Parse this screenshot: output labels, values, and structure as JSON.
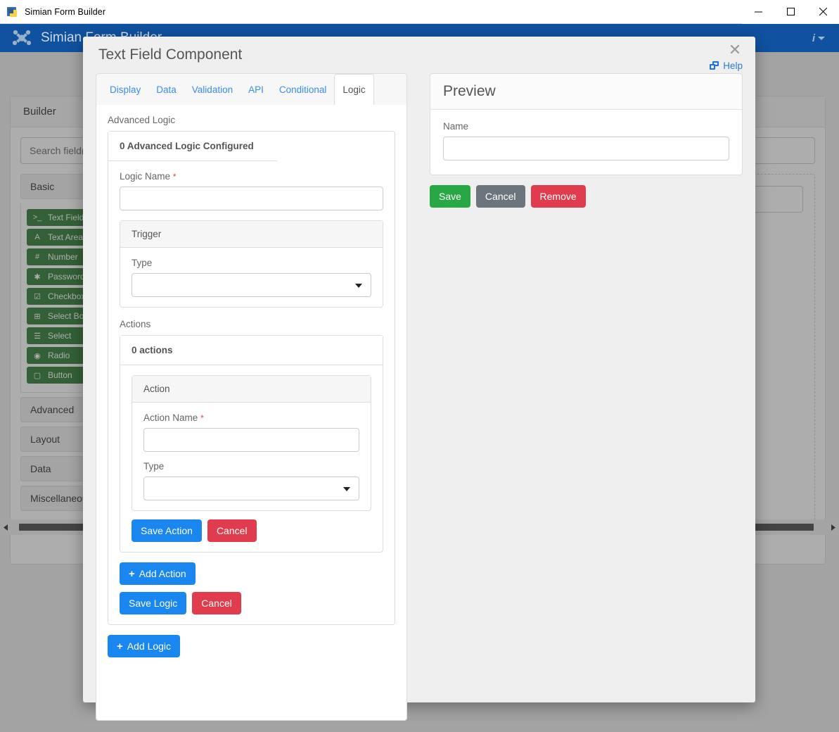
{
  "window": {
    "title": "Simian Form Builder",
    "icon": "python-app-icon",
    "controls": {
      "minimize": "minimize-icon",
      "maximize": "maximize-icon",
      "close": "close-icon"
    }
  },
  "appbar": {
    "logo": "simian-logo",
    "title": "Simian Form Builder",
    "info_icon": "info-icon",
    "caret": "chevron-down-icon"
  },
  "background": {
    "builder_card_title": "Builder",
    "search_placeholder": "Search field(s)",
    "groups": [
      {
        "label": "Basic",
        "expanded": true
      },
      {
        "label": "Advanced",
        "expanded": false
      },
      {
        "label": "Layout",
        "expanded": false
      },
      {
        "label": "Data",
        "expanded": false
      },
      {
        "label": "Miscellaneous",
        "expanded": false
      }
    ],
    "components": [
      {
        "label": "Text Field",
        "icon": ">_"
      },
      {
        "label": "Text Area",
        "icon": "A"
      },
      {
        "label": "Number",
        "icon": "#"
      },
      {
        "label": "Password",
        "icon": "✱"
      },
      {
        "label": "Checkbox",
        "icon": "☑"
      },
      {
        "label": "Select Boxes",
        "icon": "⊞"
      },
      {
        "label": "Select",
        "icon": "☰"
      },
      {
        "label": "Radio",
        "icon": "◉"
      },
      {
        "label": "Button",
        "icon": "▢"
      }
    ],
    "scrollbar": {
      "left_arrow": "chevron-left-icon",
      "right_arrow": "chevron-right-icon"
    }
  },
  "modal": {
    "title": "Text Field Component",
    "close_icon": "close-icon",
    "help": {
      "label": "Help",
      "icon": "external-window-icon"
    },
    "tabs": [
      {
        "label": "Display",
        "active": false
      },
      {
        "label": "Data",
        "active": false
      },
      {
        "label": "Validation",
        "active": false
      },
      {
        "label": "API",
        "active": false
      },
      {
        "label": "Conditional",
        "active": false
      },
      {
        "label": "Logic",
        "active": true
      }
    ],
    "logic": {
      "section_label": "Advanced Logic",
      "summary": "0 Advanced Logic Configured",
      "logic_name_label": "Logic Name",
      "logic_name_required": "*",
      "logic_name_value": "",
      "trigger": {
        "header": "Trigger",
        "type_label": "Type",
        "type_value": "",
        "caret": "chevron-down-icon"
      },
      "actions_label": "Actions",
      "actions_summary": "0 actions",
      "action": {
        "header": "Action",
        "name_label": "Action Name",
        "name_required": "*",
        "name_value": "",
        "type_label": "Type",
        "type_value": "",
        "caret": "chevron-down-icon",
        "save_label": "Save Action",
        "cancel_label": "Cancel"
      },
      "add_action_label": "Add Action",
      "save_logic_label": "Save Logic",
      "cancel_logic_label": "Cancel",
      "add_logic_label": "Add Logic",
      "plus": "+"
    },
    "preview": {
      "header": "Preview",
      "field_label": "Name",
      "field_value": "",
      "save_label": "Save",
      "cancel_label": "Cancel",
      "remove_label": "Remove"
    }
  },
  "colors": {
    "appbar": "#10529f",
    "primary": "#1a86f0",
    "danger": "#e03c4e",
    "success": "#28a745",
    "secondary": "#6c757d",
    "link": "#3b8cf0",
    "component": "#2d7a33"
  }
}
